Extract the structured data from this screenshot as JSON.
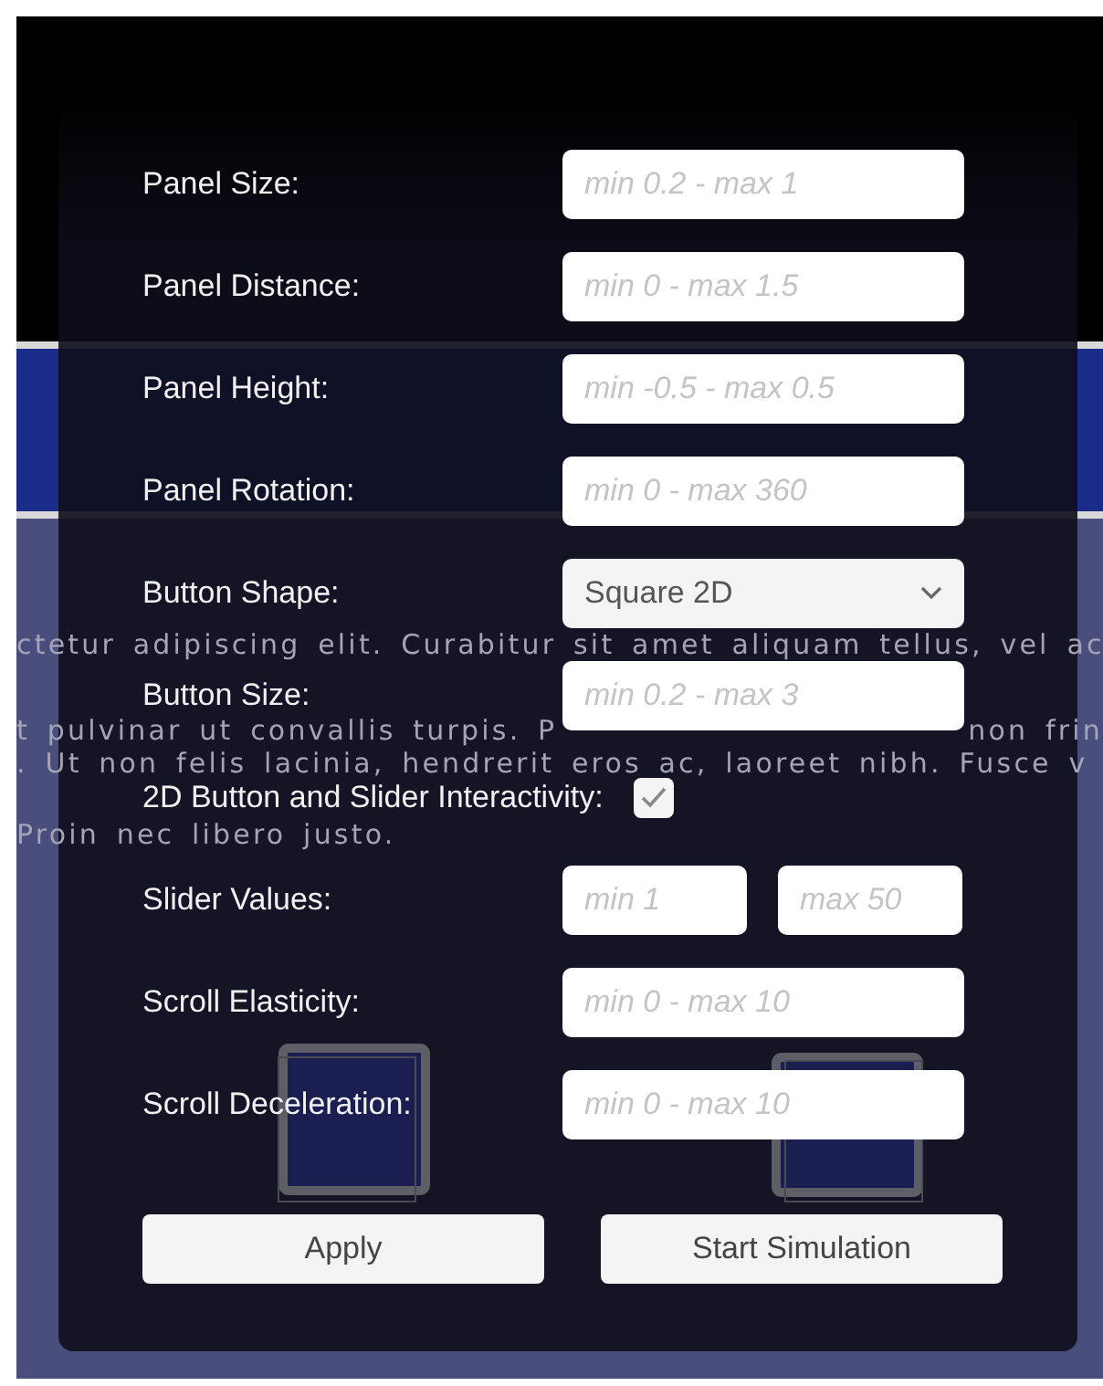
{
  "background_text": [
    {
      "segments": [
        "ctetur adipiscing elit. Curabitur sit amet aliquam tellus, vel ac"
      ]
    },
    {
      "segments": [
        "t pulvinar ut convallis turpis. P",
        "non frin"
      ]
    },
    {
      "segments": [
        ". Ut non felis lacinia, hendrerit eros ac, laoreet nibh. Fusce v"
      ]
    },
    {
      "segments": [
        "Proin nec libero justo."
      ]
    }
  ],
  "form": {
    "rows": [
      {
        "kind": "field",
        "label": "Panel Size:",
        "placeholder": "min 0.2 - max 1"
      },
      {
        "kind": "field",
        "label": "Panel Distance:",
        "placeholder": "min 0 - max 1.5"
      },
      {
        "kind": "field",
        "label": "Panel Height:",
        "placeholder": "min -0.5 - max 0.5"
      },
      {
        "kind": "field",
        "label": "Panel Rotation:",
        "placeholder": "min 0 - max 360"
      },
      {
        "kind": "dropdown",
        "label": "Button Shape:",
        "value": "Square 2D"
      },
      {
        "kind": "field",
        "label": "Button Size:",
        "placeholder": "min 0.2 - max 3"
      },
      {
        "kind": "checkbox",
        "label": "2D Button and Slider Interactivity:",
        "checked": true
      },
      {
        "kind": "range",
        "label": "Slider Values:",
        "placeholders": [
          "min 1",
          "max 50"
        ]
      },
      {
        "kind": "field",
        "label": "Scroll Elasticity:",
        "placeholder": "min 0 - max 10"
      },
      {
        "kind": "field",
        "label": "Scroll Deceleration:",
        "placeholder": "min 0 - max 10"
      }
    ]
  },
  "buttons": [
    "Apply",
    "Start Simulation"
  ]
}
